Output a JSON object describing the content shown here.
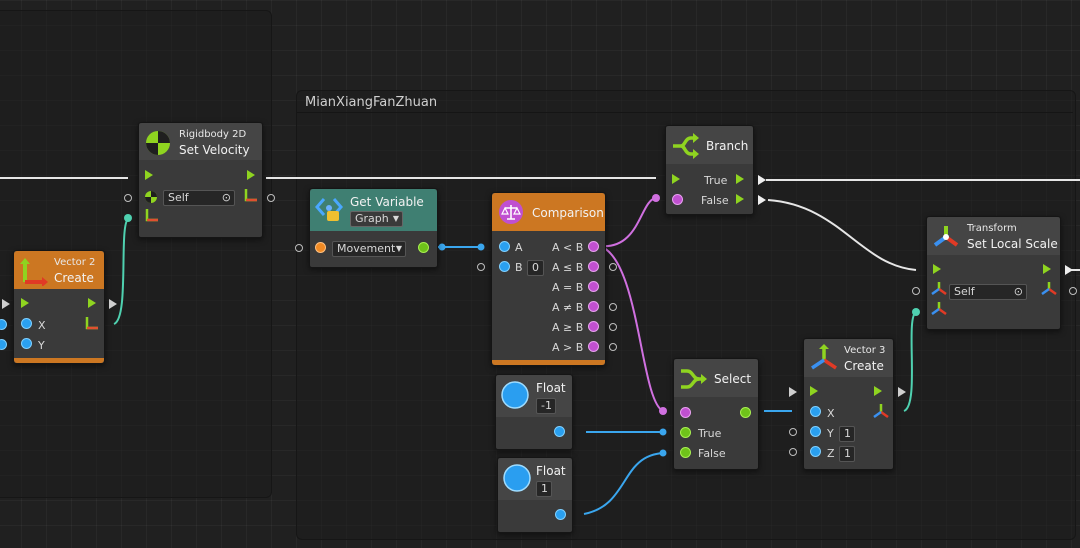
{
  "group": {
    "title": "MianXiangFanZhuan"
  },
  "nodes": {
    "set_velocity": {
      "category": "Rigidbody 2D",
      "title": "Set Velocity",
      "target": "Self"
    },
    "vector2": {
      "category": "Vector 2",
      "title": "Create",
      "x_label": "X",
      "y_label": "Y"
    },
    "get_variable": {
      "title": "Get Variable",
      "kind": "Graph",
      "name": "Movement"
    },
    "comparison": {
      "title": "Comparison",
      "a_label": "A",
      "b_label": "B",
      "b_value": "0",
      "outputs": [
        "A < B",
        "A ≤ B",
        "A = B",
        "A ≠ B",
        "A ≥ B",
        "A > B"
      ]
    },
    "branch": {
      "title": "Branch",
      "true_label": "True",
      "false_label": "False"
    },
    "float1": {
      "title": "Float",
      "value": "-1"
    },
    "float2": {
      "title": "Float",
      "value": "1"
    },
    "select": {
      "title": "Select",
      "true_label": "True",
      "false_label": "False"
    },
    "vector3": {
      "category": "Vector 3",
      "title": "Create",
      "x_label": "X",
      "y_label": "Y",
      "z_label": "Z",
      "y_value": "1",
      "z_value": "1"
    },
    "set_scale": {
      "category": "Transform",
      "title": "Set Local Scale",
      "target": "Self"
    }
  },
  "colors": {
    "flow": "#8fd420",
    "float": "#2aa0f0",
    "bool": "#c050d0",
    "object": "#6fc21a",
    "orange_header": "#cc7722",
    "teal_header": "#3f7f72"
  },
  "icons": {
    "set_velocity": "rigidbody-icon",
    "vector2": "vector2-icon",
    "get_variable": "variable-icon",
    "comparison": "balance-scale-icon",
    "branch": "branch-icon",
    "select": "select-icon",
    "vector3": "vector3-icon",
    "set_scale": "transform-icon"
  }
}
